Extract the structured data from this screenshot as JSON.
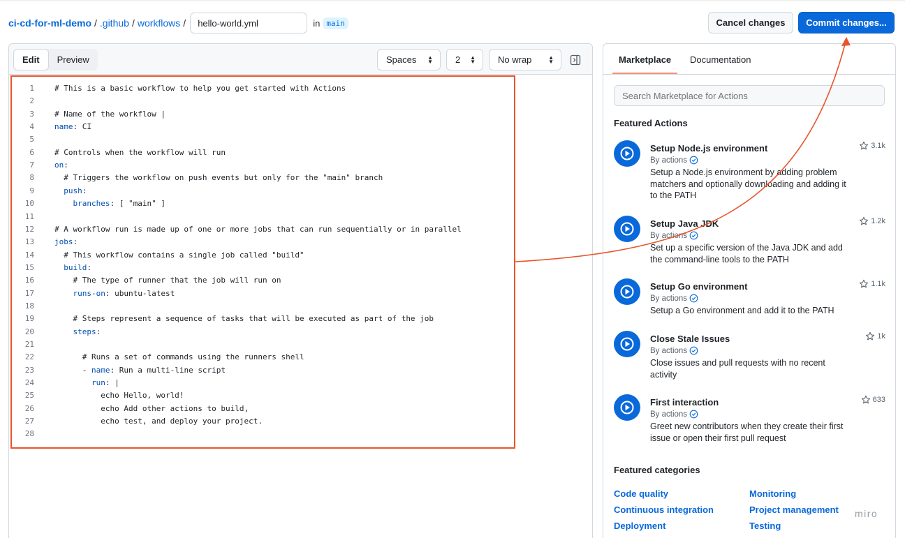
{
  "breadcrumb": {
    "repo": "ci-cd-for-ml-demo",
    "sep": "/",
    "folders": [
      ".github",
      "workflows"
    ],
    "filename": "hello-world.yml",
    "in_label": "in",
    "branch": "main"
  },
  "buttons": {
    "cancel": "Cancel changes",
    "commit": "Commit changes..."
  },
  "editor": {
    "tabs": [
      {
        "label": "Edit",
        "active": true
      },
      {
        "label": "Preview",
        "active": false
      }
    ],
    "indent_mode": "Spaces",
    "indent_size": "2",
    "wrap_mode": "No wrap",
    "lines": [
      {
        "n": "1",
        "text": "# This is a basic workflow to help you get started with Actions"
      },
      {
        "n": "2",
        "text": ""
      },
      {
        "n": "3",
        "text": "# Name of the workflow |"
      },
      {
        "n": "4",
        "text": "name: CI"
      },
      {
        "n": "5",
        "text": ""
      },
      {
        "n": "6",
        "text": "# Controls when the workflow will run"
      },
      {
        "n": "7",
        "text": "on:"
      },
      {
        "n": "8",
        "text": "  # Triggers the workflow on push events but only for the \"main\" branch"
      },
      {
        "n": "9",
        "text": "  push:"
      },
      {
        "n": "10",
        "text": "    branches: [ \"main\" ]"
      },
      {
        "n": "11",
        "text": ""
      },
      {
        "n": "12",
        "text": "# A workflow run is made up of one or more jobs that can run sequentially or in parallel"
      },
      {
        "n": "13",
        "text": "jobs:"
      },
      {
        "n": "14",
        "text": "  # This workflow contains a single job called \"build\""
      },
      {
        "n": "15",
        "text": "  build:"
      },
      {
        "n": "16",
        "text": "    # The type of runner that the job will run on"
      },
      {
        "n": "17",
        "text": "    runs-on: ubuntu-latest"
      },
      {
        "n": "18",
        "text": ""
      },
      {
        "n": "19",
        "text": "    # Steps represent a sequence of tasks that will be executed as part of the job"
      },
      {
        "n": "20",
        "text": "    steps:"
      },
      {
        "n": "21",
        "text": ""
      },
      {
        "n": "22",
        "text": "      # Runs a set of commands using the runners shell"
      },
      {
        "n": "23",
        "text": "      - name: Run a multi-line script"
      },
      {
        "n": "24",
        "text": "        run: |"
      },
      {
        "n": "25",
        "text": "          echo Hello, world!"
      },
      {
        "n": "26",
        "text": "          echo Add other actions to build,"
      },
      {
        "n": "27",
        "text": "          echo test, and deploy your project."
      },
      {
        "n": "28",
        "text": ""
      }
    ]
  },
  "sidebar": {
    "tabs": [
      {
        "label": "Marketplace",
        "active": true
      },
      {
        "label": "Documentation",
        "active": false
      }
    ],
    "search_placeholder": "Search Marketplace for Actions",
    "featured_actions_heading": "Featured Actions",
    "actions": [
      {
        "name": "Setup Node.js environment",
        "by": "By actions",
        "stars": "3.1k",
        "desc": "Setup a Node.js environment by adding problem matchers and optionally downloading and adding it to the PATH"
      },
      {
        "name": "Setup Java JDK",
        "by": "By actions",
        "stars": "1.2k",
        "desc": "Set up a specific version of the Java JDK and add the command-line tools to the PATH"
      },
      {
        "name": "Setup Go environment",
        "by": "By actions",
        "stars": "1.1k",
        "desc": "Setup a Go environment and add it to the PATH"
      },
      {
        "name": "Close Stale Issues",
        "by": "By actions",
        "stars": "1k",
        "desc": "Close issues and pull requests with no recent activity"
      },
      {
        "name": "First interaction",
        "by": "By actions",
        "stars": "633",
        "desc": "Greet new contributors when they create their first issue or open their first pull request"
      }
    ],
    "featured_categories_heading": "Featured categories",
    "categories": [
      "Code quality",
      "Monitoring",
      "Continuous integration",
      "Project management",
      "Deployment",
      "Testing"
    ],
    "watermark": "miro"
  },
  "colors": {
    "accent": "#0969da",
    "annotation": "#e8552b",
    "action_icon": "#0969da"
  }
}
